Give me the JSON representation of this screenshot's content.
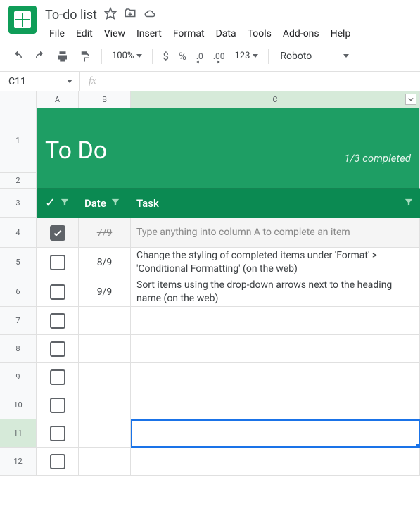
{
  "doc": {
    "title": "To-do list"
  },
  "menus": [
    "File",
    "Edit",
    "View",
    "Insert",
    "Format",
    "Data",
    "Tools",
    "Add-ons",
    "Help"
  ],
  "toolbar": {
    "zoom": "100%",
    "currency": "$",
    "percent": "%",
    "dec_minus": ".0",
    "dec_plus": ".00",
    "numfmt": "123",
    "font": "Roboto"
  },
  "namebox": "C11",
  "fx_label": "fx",
  "cols": {
    "A": "A",
    "B": "B",
    "C": "C"
  },
  "rownums": [
    "1",
    "2",
    "3",
    "4",
    "5",
    "6",
    "7",
    "8",
    "9",
    "10",
    "11",
    "12"
  ],
  "header": {
    "title": "To Do",
    "progress": "1/3 completed",
    "check": "✓",
    "date": "Date",
    "task": "Task"
  },
  "rows": [
    {
      "checked": true,
      "date": "7/9",
      "task": "Type anything into column A to complete an item"
    },
    {
      "checked": false,
      "date": "8/9",
      "task": "Change the styling of completed items under 'Format' > 'Conditional Formatting' (on the web)"
    },
    {
      "checked": false,
      "date": "9/9",
      "task": "Sort items using the drop-down arrows next to the heading name (on the web)"
    }
  ]
}
